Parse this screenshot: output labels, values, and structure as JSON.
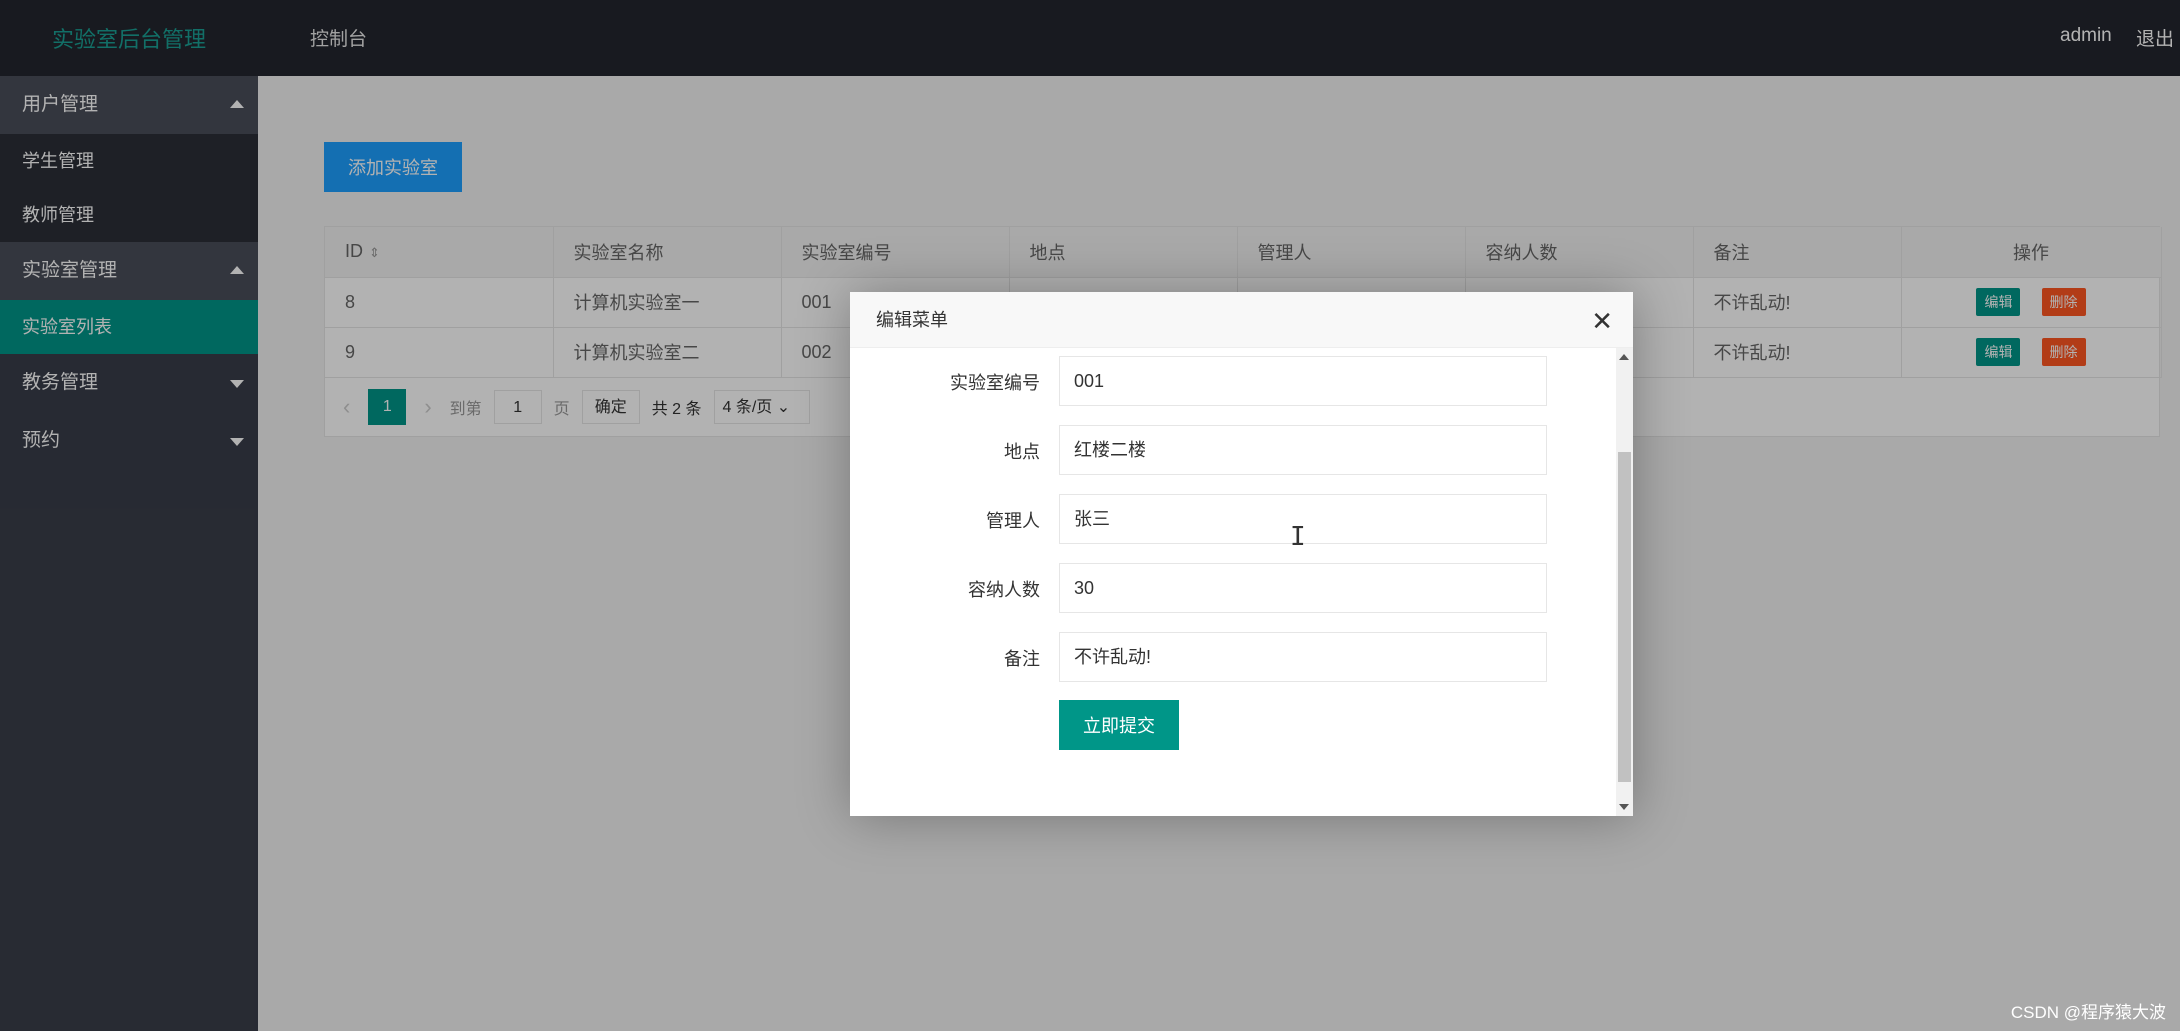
{
  "header": {
    "logo": "实验室后台管理",
    "nav_console": "控制台",
    "user": "admin",
    "logout": "退出"
  },
  "sidebar": {
    "groups": [
      {
        "label": "用户管理",
        "open": true,
        "items": [
          "学生管理",
          "教师管理"
        ]
      },
      {
        "label": "实验室管理",
        "open": true,
        "items": [
          "实验室列表"
        ]
      },
      {
        "label": "教务管理",
        "open": false,
        "items": []
      },
      {
        "label": "预约",
        "open": false,
        "items": []
      }
    ],
    "active_item": "实验室列表"
  },
  "main": {
    "add_button": "添加实验室",
    "table": {
      "columns": [
        "ID",
        "实验室名称",
        "实验室编号",
        "地点",
        "管理人",
        "容纳人数",
        "备注",
        "操作"
      ],
      "rows": [
        {
          "id": "8",
          "name": "计算机实验室一",
          "code": "001",
          "remark": "不许乱动!"
        },
        {
          "id": "9",
          "name": "计算机实验室二",
          "code": "002",
          "remark": "不许乱动!"
        }
      ],
      "edit_label": "编辑",
      "delete_label": "删除"
    },
    "pager": {
      "current": "1",
      "goto_label": "到第",
      "goto_value": "1",
      "page_label": "页",
      "confirm": "确定",
      "total": "共 2 条",
      "page_size": "4 条/页"
    }
  },
  "modal": {
    "title": "编辑菜单",
    "fields": [
      {
        "label": "实验室编号",
        "value": "001"
      },
      {
        "label": "地点",
        "value": "红楼二楼"
      },
      {
        "label": "管理人",
        "value": "张三"
      },
      {
        "label": "容纳人数",
        "value": "30"
      },
      {
        "label": "备注",
        "value": "不许乱动!"
      }
    ],
    "submit": "立即提交"
  },
  "watermark": "CSDN @程序猿大波",
  "colors": {
    "header_bg": "#23262e",
    "sidebar_bg": "#393d49",
    "accent": "#009688",
    "blue": "#1e9fff",
    "danger": "#ff5722"
  }
}
